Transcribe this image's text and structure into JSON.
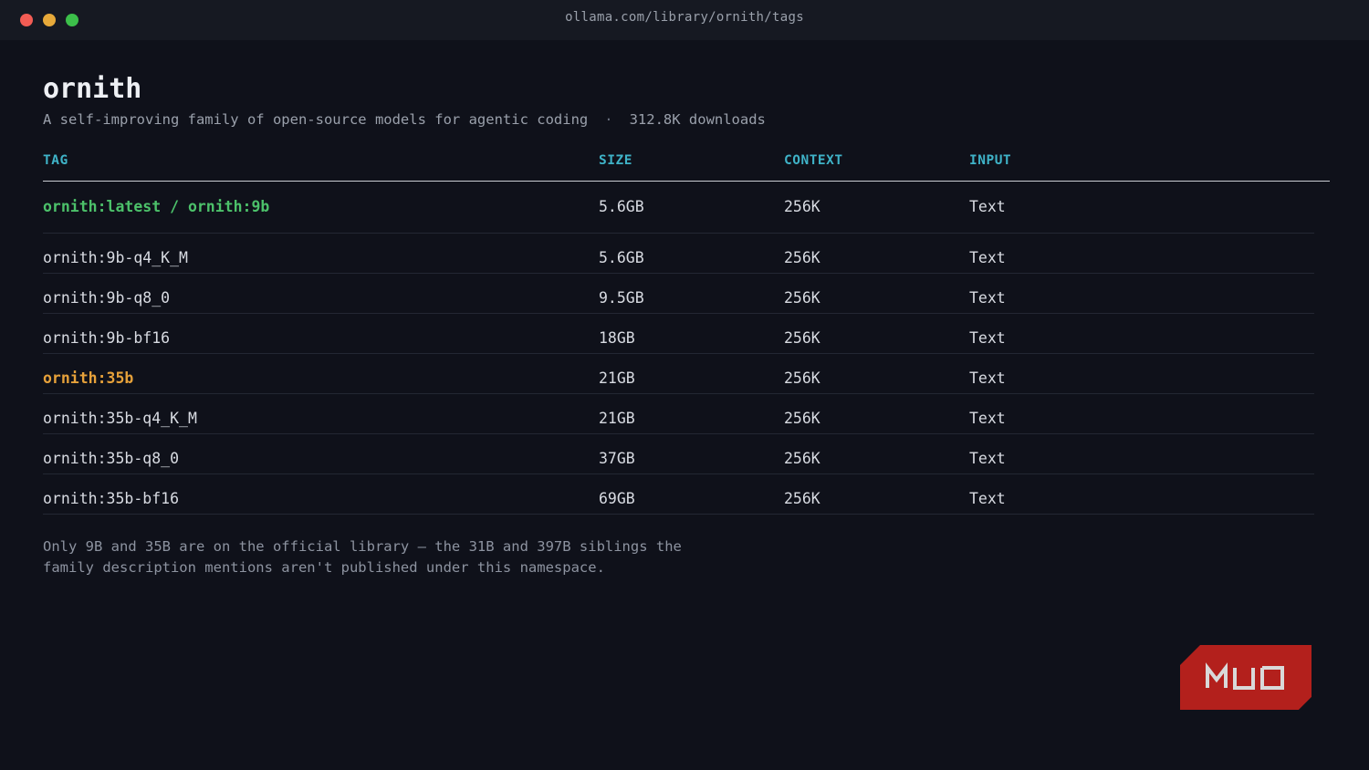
{
  "window": {
    "url": "ollama.com/library/ornith/tags"
  },
  "page": {
    "title": "ornith",
    "description": "A self-improving family of open-source models for agentic coding",
    "separator": "·",
    "downloads": "312.8K downloads"
  },
  "table": {
    "headers": [
      "TAG",
      "SIZE",
      "CONTEXT",
      "INPUT"
    ],
    "rows": [
      {
        "tag": "ornith:latest / ornith:9b",
        "size": "5.6GB",
        "context": "256K",
        "input": "Text",
        "highlight": "green"
      },
      {
        "tag": "ornith:9b-q4_K_M",
        "size": "5.6GB",
        "context": "256K",
        "input": "Text",
        "highlight": ""
      },
      {
        "tag": "ornith:9b-q8_0",
        "size": "9.5GB",
        "context": "256K",
        "input": "Text",
        "highlight": ""
      },
      {
        "tag": "ornith:9b-bf16",
        "size": "18GB",
        "context": "256K",
        "input": "Text",
        "highlight": ""
      },
      {
        "tag": "ornith:35b",
        "size": "21GB",
        "context": "256K",
        "input": "Text",
        "highlight": "orange"
      },
      {
        "tag": "ornith:35b-q4_K_M",
        "size": "21GB",
        "context": "256K",
        "input": "Text",
        "highlight": ""
      },
      {
        "tag": "ornith:35b-q8_0",
        "size": "37GB",
        "context": "256K",
        "input": "Text",
        "highlight": ""
      },
      {
        "tag": "ornith:35b-bf16",
        "size": "69GB",
        "context": "256K",
        "input": "Text",
        "highlight": ""
      }
    ]
  },
  "note": {
    "line1": "Only 9B and 35B are on the official library — the 31B and 397B siblings the",
    "line2": "family description mentions aren't published under this namespace."
  },
  "watermark": {
    "text": "MUO",
    "color": "#b3201c"
  },
  "colors": {
    "accent_header": "#3fb3c8",
    "tag_green": "#4cc16a",
    "tag_orange": "#e6a13a"
  }
}
